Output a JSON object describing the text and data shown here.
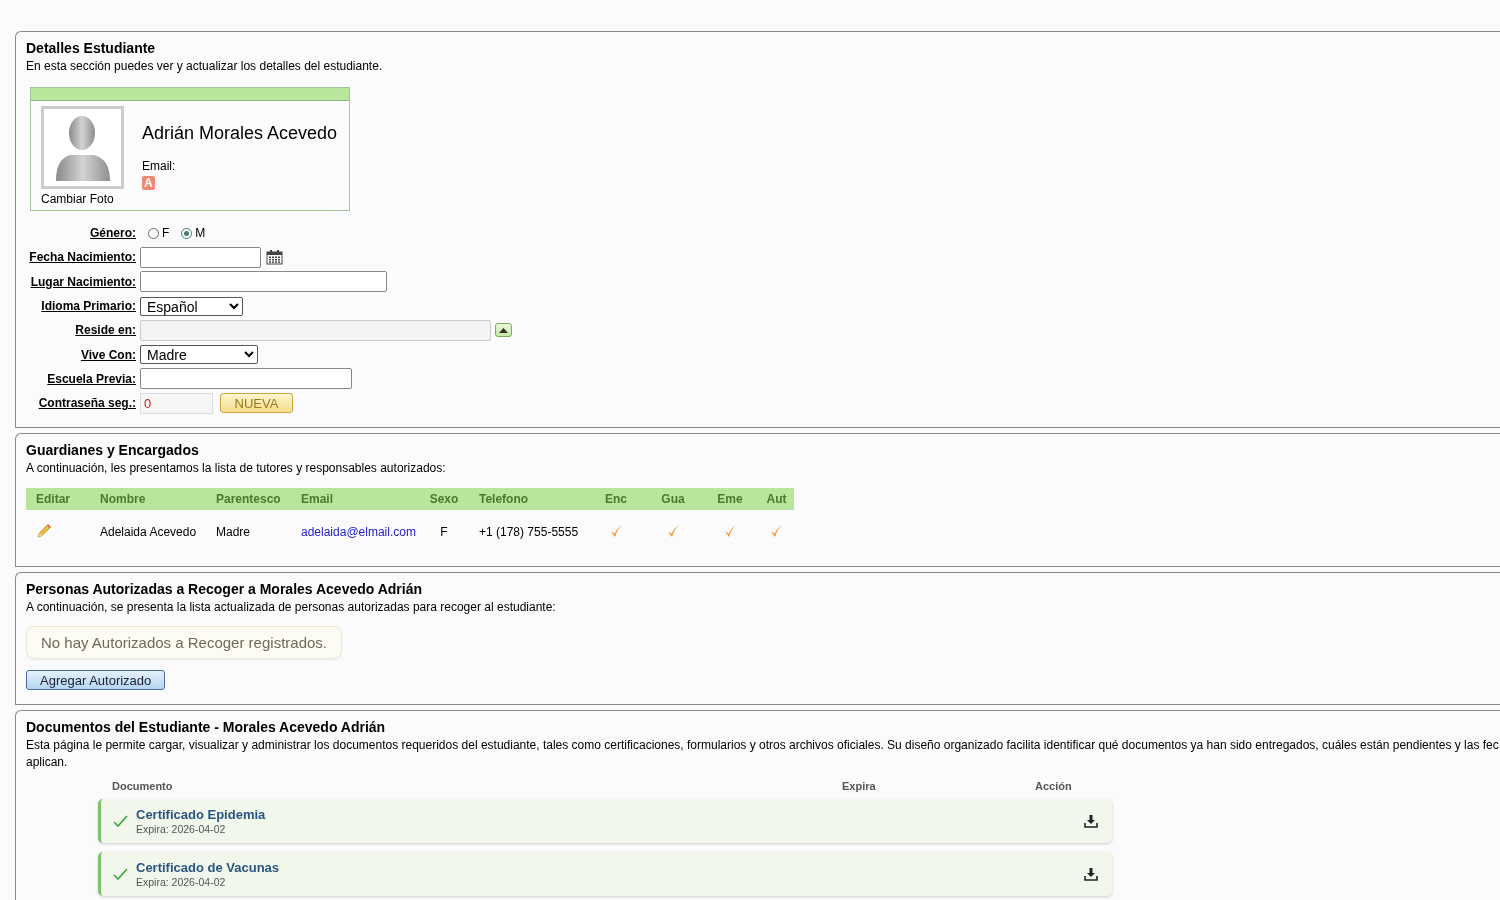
{
  "student_details": {
    "title": "Detalles Estudiante",
    "description": "En esta sección puedes ver y actualizar los detalles del estudiante.",
    "profile": {
      "name": "Adrián Morales Acevedo",
      "email_label": "Email:",
      "email_badge": "A",
      "photo_link": "Cambiar Foto"
    },
    "fields": [
      {
        "kind": "radio",
        "label": "Género:",
        "options": [
          {
            "label": "F",
            "selected": false
          },
          {
            "label": "M",
            "selected": true
          }
        ]
      },
      {
        "kind": "date",
        "label": "Fecha Nacimiento:"
      },
      {
        "kind": "text",
        "label": "Lugar Nacimiento:"
      },
      {
        "kind": "select",
        "label": "Idioma Primario:",
        "value": "Español"
      },
      {
        "kind": "lookup",
        "label": "Reside en:",
        "disabled": true
      },
      {
        "kind": "select",
        "label": "Vive Con:",
        "value": "Madre"
      },
      {
        "kind": "text",
        "label": "Escuela Previa:"
      },
      {
        "kind": "code",
        "label": "Contraseña seg.:",
        "value": "0",
        "button": "NUEVA"
      }
    ]
  },
  "guardians": {
    "title": "Guardianes y Encargados",
    "description": "A continuación, les presentamos la lista de tutores y responsables autorizados:",
    "columns": [
      "Editar",
      "Nombre",
      "Parentesco",
      "Email",
      "Sexo",
      "Telefono",
      "Enc",
      "Gua",
      "Eme",
      "Aut"
    ],
    "rows": [
      {
        "nombre": "Adelaida Acevedo",
        "parentesco": "Madre",
        "email": "adelaida@elmail.com",
        "sexo": "F",
        "telefono": "+1 (178) 755-5555",
        "checks": [
          true,
          true,
          true,
          true
        ]
      }
    ]
  },
  "authorized": {
    "title": "Personas Autorizadas a Recoger a Morales Acevedo Adrián",
    "description": "A continuación, se presenta la lista actualizada de personas autorizadas para recoger al estudiante:",
    "empty_message": "No hay Autorizados a Recoger registrados.",
    "button": "Agregar Autorizado"
  },
  "documents": {
    "title": "Documentos del Estudiante - Morales Acevedo Adrián",
    "description_lines": [
      "Esta página le permite cargar, visualizar y administrar los documentos requeridos del estudiante, tales como certificaciones, formularios y otros archivos oficiales. Su diseño organizado facilita identificar qué documentos ya han sido entregados, cuáles están pendientes y las fec",
      "aplican."
    ],
    "columns": [
      "Documento",
      "Expira",
      "Acción"
    ],
    "items": [
      {
        "title": "Certificado Epidemia",
        "expires": "Expira: 2026-04-02",
        "delivered": true
      },
      {
        "title": "Certificado de Vacunas",
        "expires": "Expira: 2026-04-02",
        "delivered": true
      }
    ]
  }
}
